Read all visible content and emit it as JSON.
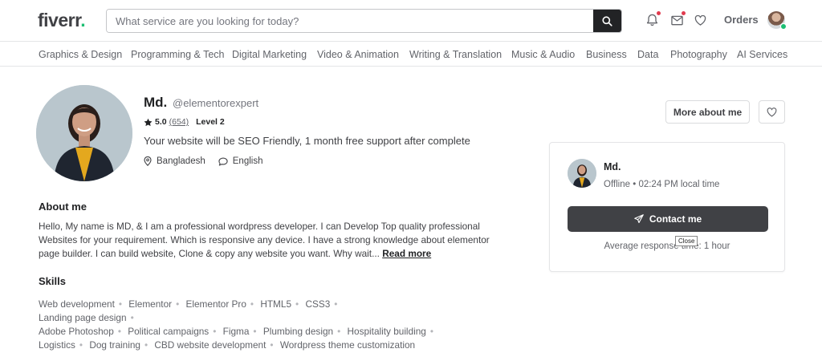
{
  "header": {
    "logo_text": "fiverr",
    "logo_dot": ".",
    "search_placeholder": "What service are you looking for today?",
    "orders_label": "Orders"
  },
  "categories": [
    "Graphics & Design",
    "Programming & Tech",
    "Digital Marketing",
    "Video & Animation",
    "Writing & Translation",
    "Music & Audio",
    "Business",
    "Data",
    "Photography",
    "AI Services"
  ],
  "profile": {
    "name": "Md.",
    "username": "@elementorexpert",
    "rating": "5.0",
    "review_count": "(654)",
    "level": "Level 2",
    "tagline": "Your website will be SEO Friendly, 1 month free support after complete",
    "country": "Bangladesh",
    "language": "English",
    "more_about_label": "More about me"
  },
  "about": {
    "title": "About me",
    "text": "Hello, My name is MD, & I am a professional wordpress developer. I can Develop Top quality professional Websites for your requirement. Which is responsive any device. I have a strong knowledge about elementor page builder. I can build website, Clone & copy any website you want. Why wait...",
    "read_more": "Read more"
  },
  "skills": {
    "title": "Skills",
    "items": [
      "Web development",
      "Elementor",
      "Elementor Pro",
      "HTML5",
      "CSS3",
      "Landing page design",
      "Adobe Photoshop",
      "Political campaigns",
      "Figma",
      "Plumbing design",
      "Hospitality building",
      "Logistics",
      "Dog training",
      "CBD website development",
      "Wordpress theme customization"
    ]
  },
  "contact_card": {
    "name": "Md.",
    "status": "Offline • 02:24 PM local time",
    "contact_label": "Contact me",
    "response": "Average response time: 1 hour",
    "tooltip": "Close"
  },
  "colors": {
    "brand_green": "#1dbf73",
    "notification_red": "#e13b4f",
    "contact_button": "#404145"
  }
}
